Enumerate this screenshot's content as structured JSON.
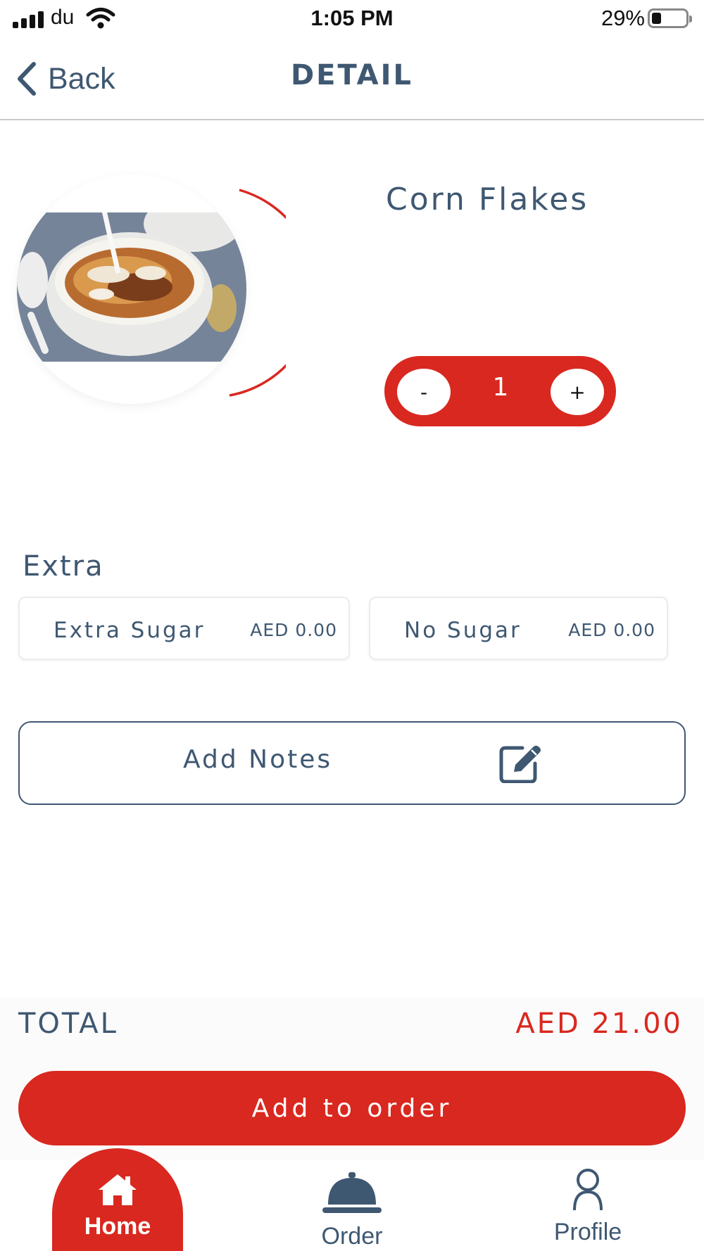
{
  "status_bar": {
    "carrier": "du",
    "time": "1:05 PM",
    "battery_percent": "29%",
    "battery_level": 0.29,
    "icons": [
      "signal-icon",
      "wifi-icon",
      "battery-icon"
    ]
  },
  "nav": {
    "back_label": "Back",
    "title": "DETAIL",
    "back_icon": "chevron-left-icon"
  },
  "product": {
    "name": "Corn Flakes",
    "image": "cereal-bowl-image",
    "quantity": "1",
    "minus_label": "-",
    "plus_label": "+"
  },
  "extras": {
    "title": "Extra",
    "items": [
      {
        "name": "Extra Sugar",
        "price": "AED 0.00"
      },
      {
        "name": "No Sugar",
        "price": "AED 0.00"
      }
    ]
  },
  "notes": {
    "label": "Add Notes",
    "icon": "edit-note-icon"
  },
  "order": {
    "total_label": "TOTAL",
    "total_value": "AED 21.00",
    "add_button_label": "Add to order"
  },
  "tab_bar": {
    "active": "Home",
    "tabs": [
      {
        "label": "Home",
        "icon": "home-icon"
      },
      {
        "label": "Order",
        "icon": "service-bell-icon"
      },
      {
        "label": "Profile",
        "icon": "user-icon"
      }
    ]
  },
  "colors": {
    "accent": "#d9281f",
    "text": "#3f5872",
    "border": "#ececec"
  }
}
